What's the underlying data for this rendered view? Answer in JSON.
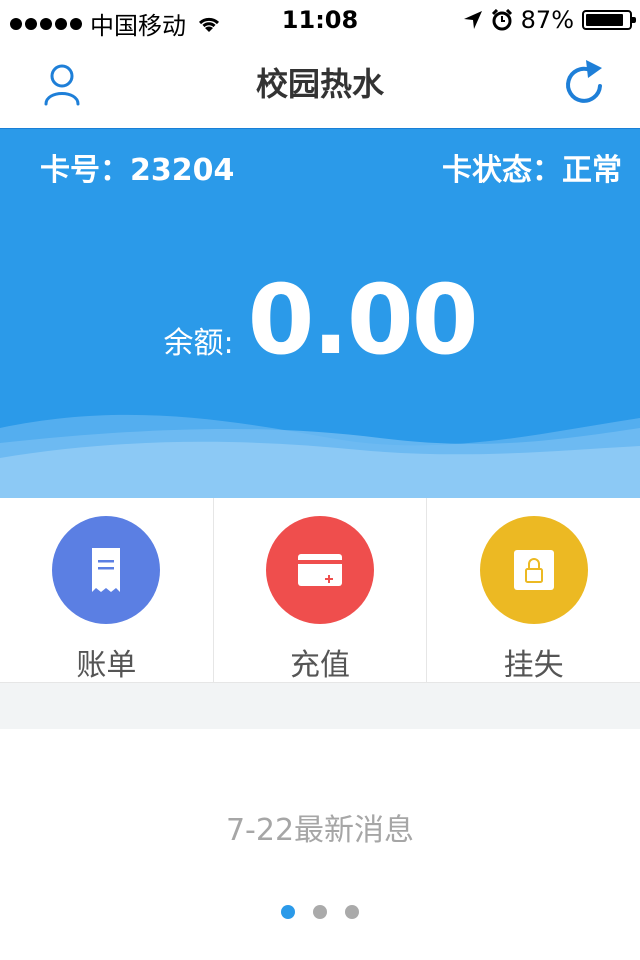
{
  "status_bar": {
    "carrier": "中国移动",
    "time": "11:08",
    "battery": "87%",
    "battery_level": 0.87
  },
  "nav": {
    "title": "校园热水",
    "left_icon": "user-icon",
    "right_icon": "refresh-icon"
  },
  "card": {
    "number_label": "卡号：",
    "number": "23204",
    "status_label": "卡状态：",
    "status": "正常",
    "balance_label": "余额:",
    "balance": "0.00"
  },
  "actions": [
    {
      "label": "账单",
      "icon": "bill-icon",
      "color": "#5b7fe3"
    },
    {
      "label": "充值",
      "icon": "card-plus-icon",
      "color": "#ef4e4d"
    },
    {
      "label": "挂失",
      "icon": "lock-icon",
      "color": "#ecb923"
    }
  ],
  "news": {
    "text": "7-22最新消息",
    "page_count": 3,
    "active_page": 1
  },
  "colors": {
    "primary": "#2b9ae9",
    "nav_icon": "#1e7fd8"
  }
}
